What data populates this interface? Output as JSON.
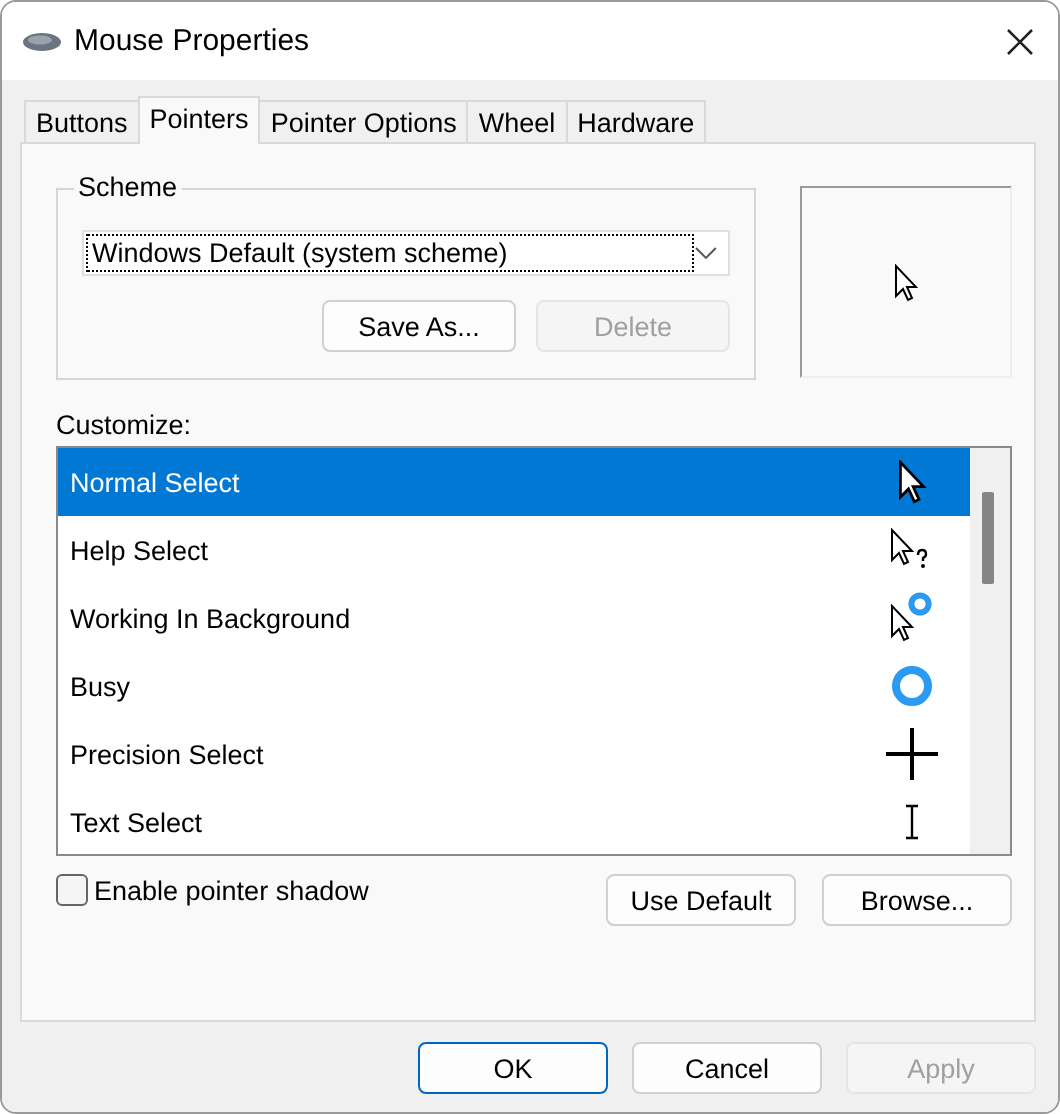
{
  "window": {
    "title": "Mouse Properties"
  },
  "tabs": [
    {
      "label": "Buttons",
      "selected": false
    },
    {
      "label": "Pointers",
      "selected": true
    },
    {
      "label": "Pointer Options",
      "selected": false
    },
    {
      "label": "Wheel",
      "selected": false
    },
    {
      "label": "Hardware",
      "selected": false
    }
  ],
  "scheme": {
    "label": "Scheme",
    "value": "Windows Default (system scheme)",
    "buttons": [
      {
        "label": "Save As...",
        "disabled": false
      },
      {
        "label": "Delete",
        "disabled": true
      }
    ]
  },
  "customize": {
    "label": "Customize:",
    "rows": [
      {
        "name": "Normal Select",
        "kind": "arrow",
        "selected": true
      },
      {
        "name": "Help Select",
        "kind": "help",
        "selected": false
      },
      {
        "name": "Working In Background",
        "kind": "working",
        "selected": false
      },
      {
        "name": "Busy",
        "kind": "busy",
        "selected": false
      },
      {
        "name": "Precision Select",
        "kind": "cross",
        "selected": false
      },
      {
        "name": "Text Select",
        "kind": "text",
        "selected": false
      }
    ]
  },
  "shadow": {
    "label": "Enable pointer shadow",
    "checked": false
  },
  "list_buttons": [
    {
      "label": "Use Default",
      "disabled": false
    },
    {
      "label": "Browse...",
      "disabled": false
    }
  ],
  "footer": [
    {
      "label": "OK",
      "disabled": false,
      "default": true
    },
    {
      "label": "Cancel",
      "disabled": false,
      "default": false
    },
    {
      "label": "Apply",
      "disabled": true,
      "default": false
    }
  ]
}
